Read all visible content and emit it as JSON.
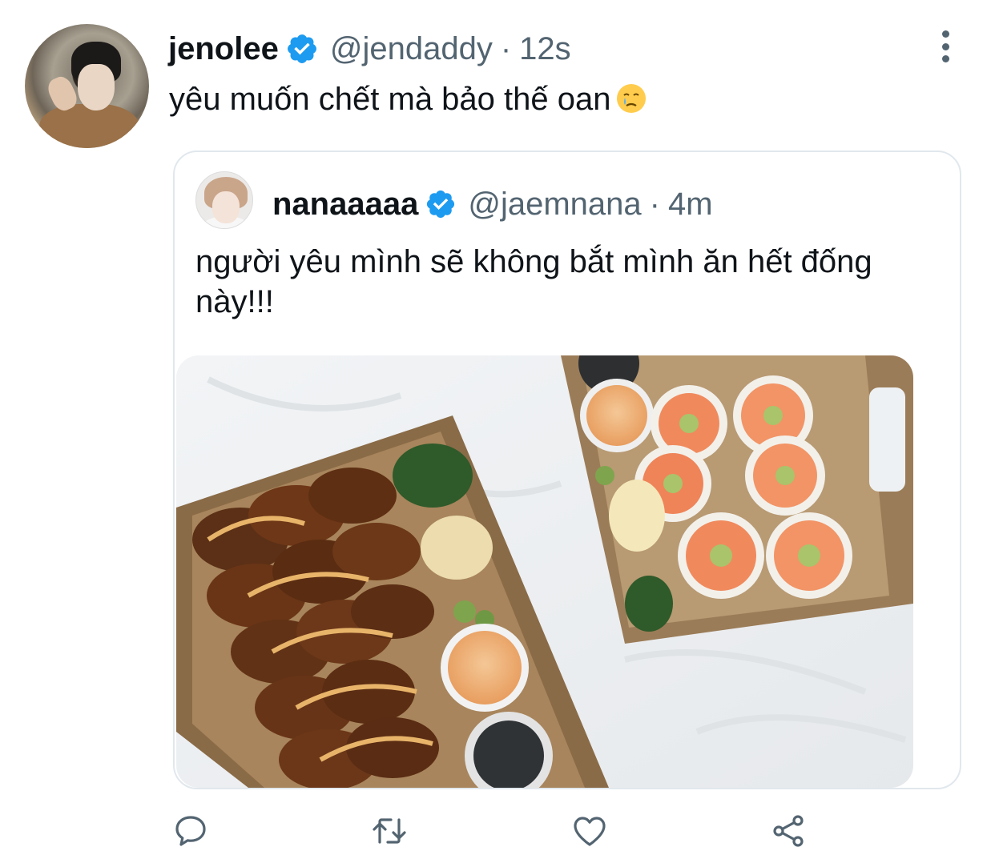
{
  "tweet": {
    "display_name": "jenolee",
    "handle": "@jendaddy",
    "separator": "·",
    "time": "12s",
    "text": "yêu muốn chết mà bảo thế oan"
  },
  "quoted_tweet": {
    "display_name": "nanaaaaa",
    "handle": "@jaemnana",
    "separator": "·",
    "time": "4m",
    "text": "người yêu mình sẽ không bắt mình ăn hết đống này!!!"
  },
  "icons": {
    "verified": "verified-badge-icon",
    "more": "more-vertical-icon",
    "emoji": "crying-face-emoji",
    "reply": "reply-icon",
    "retweet": "retweet-icon",
    "like": "heart-icon",
    "share": "share-icon"
  },
  "colors": {
    "verified_blue": "#1d9bf0",
    "secondary_text": "#536471",
    "border": "#e1e8ed"
  }
}
